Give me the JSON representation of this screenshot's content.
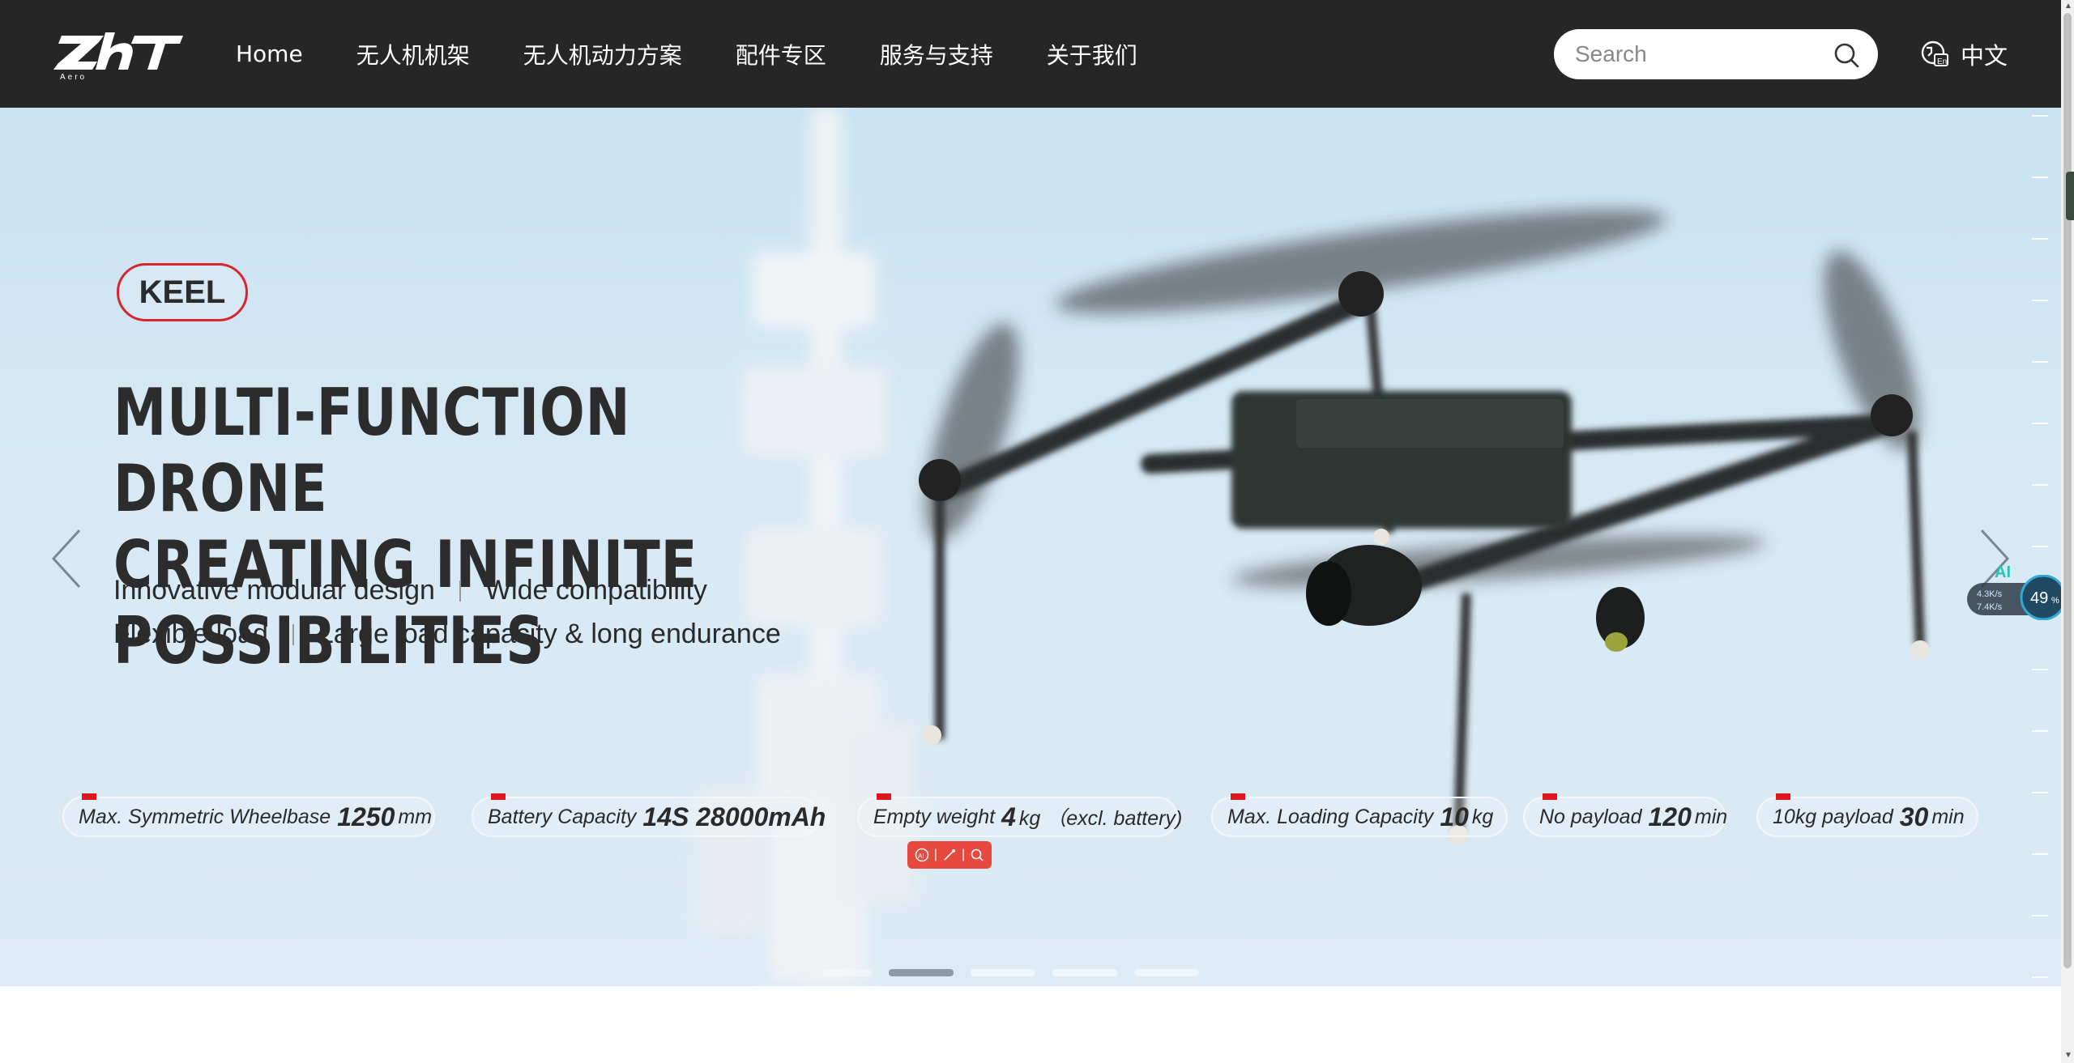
{
  "header": {
    "logo_text": "ZHT",
    "logo_sub": "Aero",
    "nav": [
      {
        "label": "Home"
      },
      {
        "label": "无人机机架"
      },
      {
        "label": "无人机动力方案"
      },
      {
        "label": "配件专区"
      },
      {
        "label": "服务与支持"
      },
      {
        "label": "关于我们"
      }
    ],
    "search": {
      "placeholder": "Search",
      "icon": "search-icon"
    },
    "language": {
      "label": "中文",
      "icon": "language-icon"
    }
  },
  "hero": {
    "badge": "KEEL",
    "headline_line1": "MULTI-FUNCTION DRONE",
    "headline_line2": "CREATING INFINITE POSSIBILITIES",
    "features_row1": [
      "Innovative modular design",
      "Wide compatibility"
    ],
    "features_row2": [
      "Flexible load",
      "Large load capacity & long endurance"
    ],
    "specs": [
      {
        "label": "Max. Symmetric Wheelbase",
        "value": "1250",
        "unit": "mm"
      },
      {
        "label": "Battery Capacity",
        "value": "14S 28000mAh",
        "unit": ""
      },
      {
        "label": "Empty weight",
        "value": "4",
        "unit": "kg （excl. battery)"
      },
      {
        "label": "Max. Loading Capacity",
        "value": "10",
        "unit": "kg"
      },
      {
        "label": "No payload",
        "value": "120",
        "unit": "min"
      },
      {
        "label": "10kg payload",
        "value": "30",
        "unit": "min"
      }
    ],
    "carousel": {
      "slide_count": 5,
      "active_index": 1
    },
    "accent_color": "#d8262f"
  },
  "overlay": {
    "ai_label": "AI",
    "upload_speed": "4.3K/s",
    "download_speed": "7.4K/s",
    "percent": "49"
  }
}
